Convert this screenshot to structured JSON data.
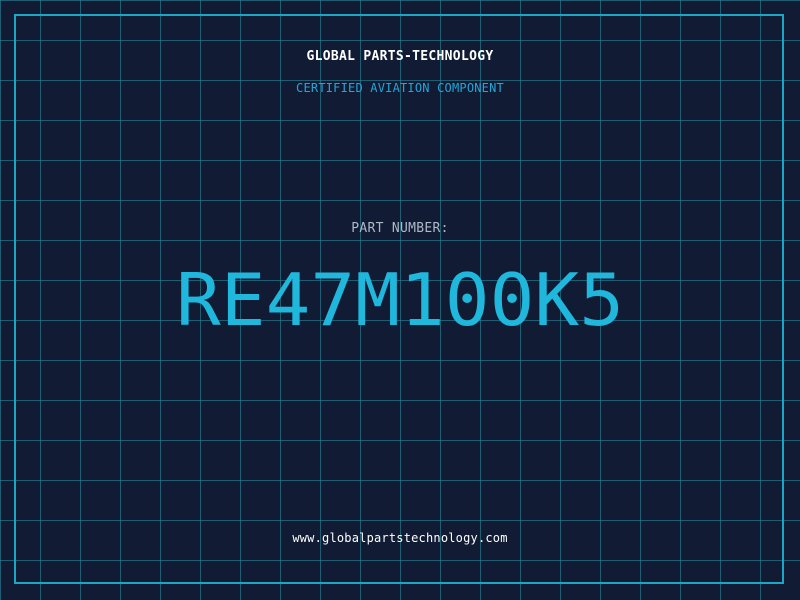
{
  "header": {
    "company": "GLOBAL PARTS-TECHNOLOGY",
    "tagline": "CERTIFIED AVIATION COMPONENT"
  },
  "part": {
    "label": "PART NUMBER:",
    "number": "RE47M100K5"
  },
  "footer": {
    "url": "www.globalpartstechnology.com"
  },
  "colors": {
    "background": "#111b33",
    "grid": "#2896aa",
    "frame": "#1aa7c6",
    "accent": "#1fb7dc",
    "tagline": "#23a6d8",
    "label": "#aeb8c9",
    "text": "#ffffff"
  }
}
